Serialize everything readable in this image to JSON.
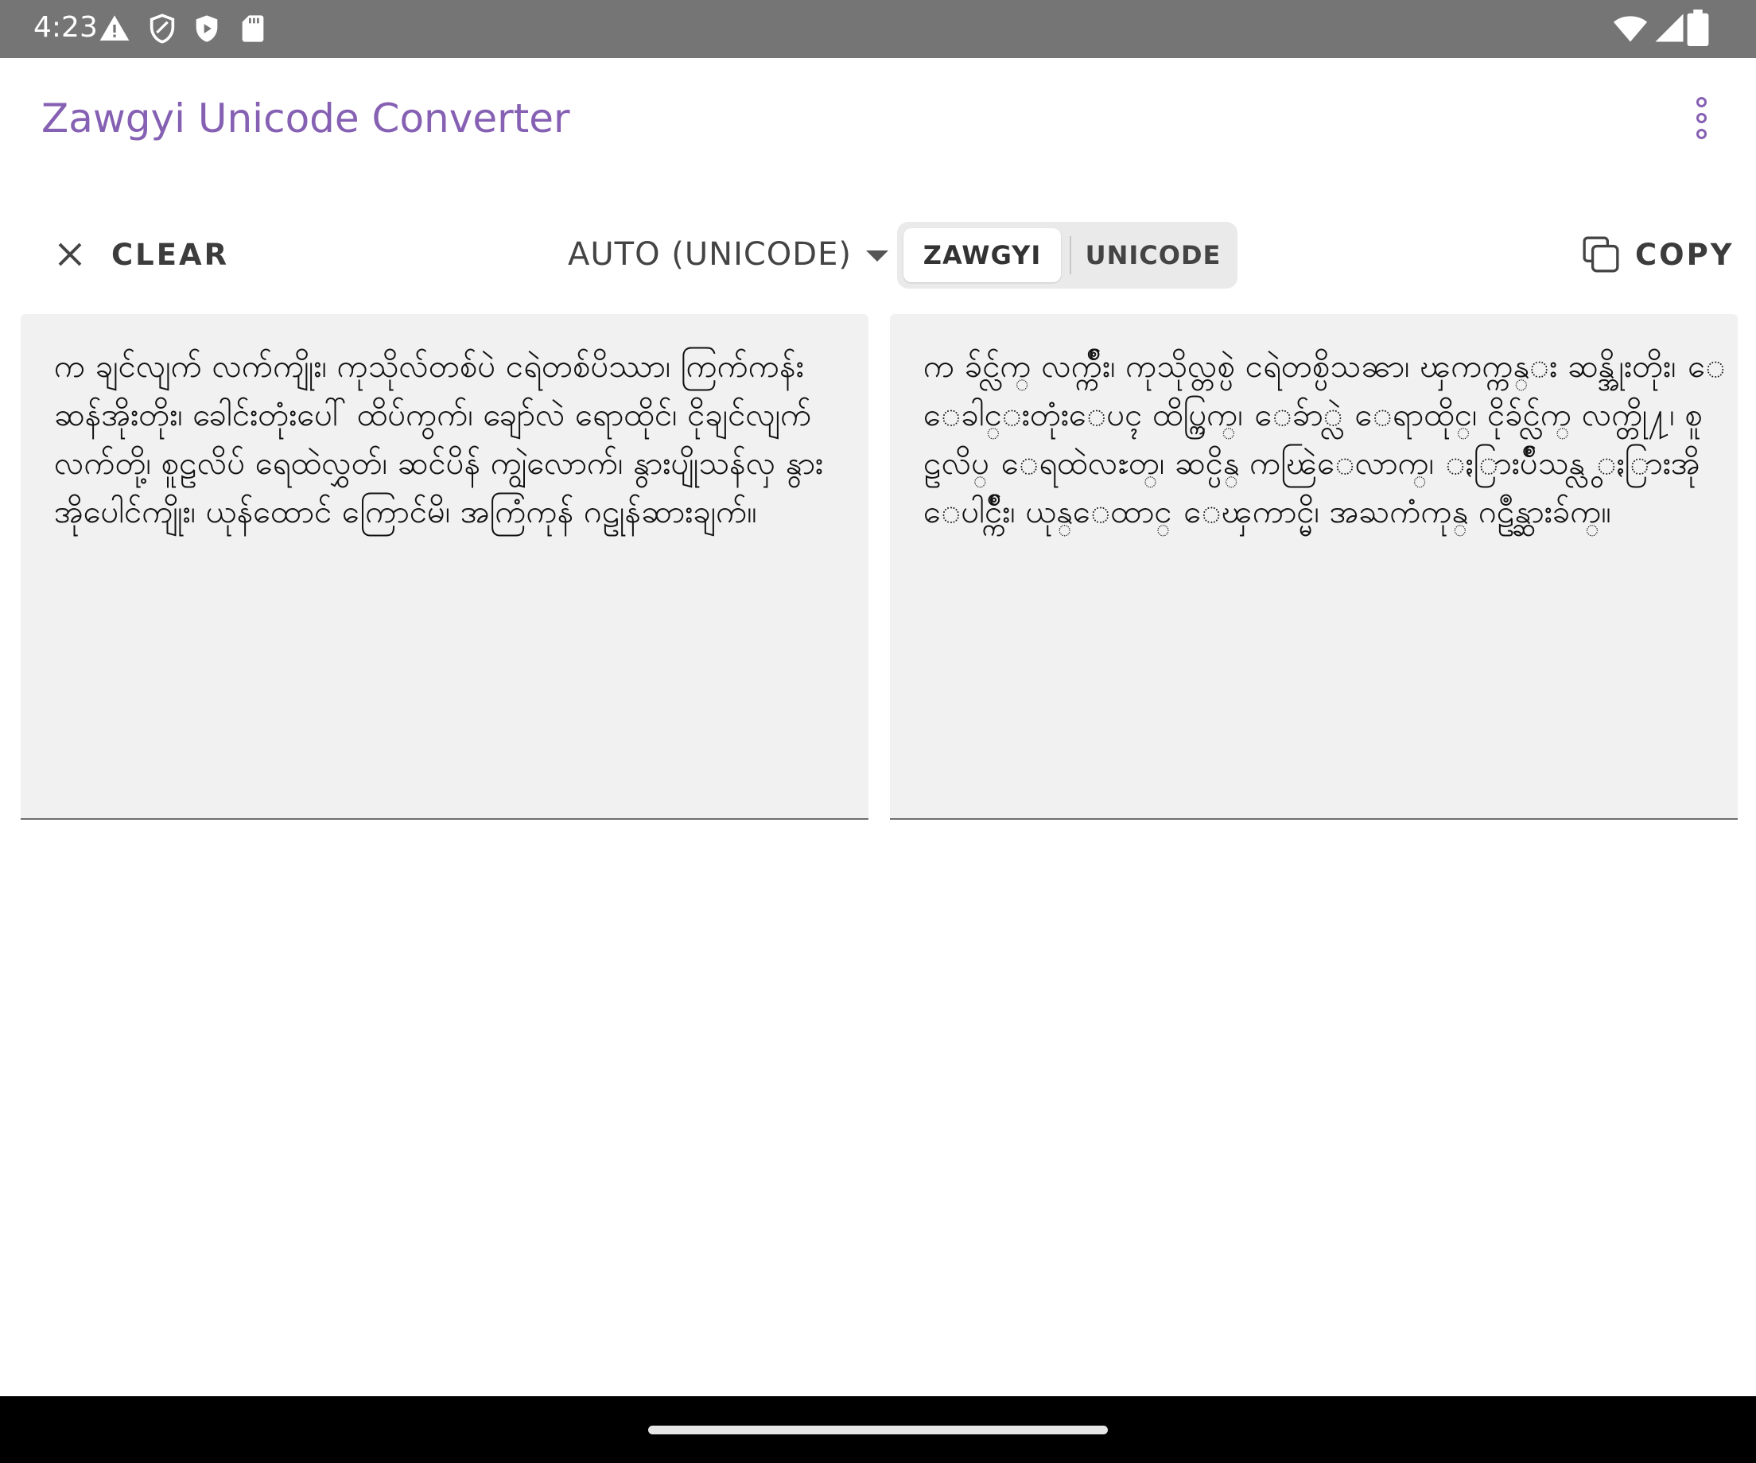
{
  "status_bar": {
    "time": "4:23",
    "left_icons": [
      "warning-icon",
      "shield-icon",
      "play-protect-icon",
      "sd-card-icon"
    ],
    "right_icons": [
      "wifi-icon",
      "signal-icon",
      "battery-icon"
    ]
  },
  "app_bar": {
    "title": "Zawgyi Unicode Converter",
    "overflow_icon": "more-vert-icon",
    "accent_color": "#8560b3"
  },
  "toolbar": {
    "clear_label": "CLEAR",
    "clear_icon": "close-icon",
    "mode_selected": "AUTO (UNICODE)",
    "target_options": [
      "ZAWGYI",
      "UNICODE"
    ],
    "target_selected": "ZAWGYI",
    "copy_label": "COPY",
    "copy_icon": "copy-icon"
  },
  "input": {
    "text": "က ချင်လျက် လက်ကျိုး၊ ကုသိုလ်တစ်ပဲ ငရဲတစ်ပိဿာ၊ ကြက်ကန်း ဆန်အိုးတိုး၊ ခေါင်းတုံးပေါ် ထိပ်ကွက်၊ ချော်လဲ ရောထိုင်၊ ငိုချင်လျက် လက်တို့၊ စူဠလိပ် ရေထဲလွှတ်၊ ဆင်ပိန် ကျွဲလောက်၊ နွားပျိုသန်လှ နွားအိုပေါင်ကျိုး၊ ယုန်ထောင် ကြောင်မိ၊ အကြံကုန် ဂဠုန်ဆားချက်။"
  },
  "output": {
    "text": "က ခ်င္လ်က္ လက္က်ိဳး၊ ကုသိုလ္တစ္ပဲ ငရဲတစ္ပိသၼာ၊ ၾကက္ကန္း ဆန္အိုးတိုး၊ ေခါင္းတုံးေပၚ ထိပ္ကြက္၊ ေခ်ာ္လဲ ေရာထိုင္၊ ငိုခ်င္လ်က္ လက္တို႔၊ စူဠလိပ္ ေရထဲလႊတ္၊ ဆင္ပိန္ ကၽြဲေလာက္၊ ႏြားပ်ိဳသန္လွ ႏြားအိုေပါင္က်ိဳး၊ ယုန္ေထာင္ ေၾကာင္မိ၊ အႀကံကုန္ ဂဠဳန္ဆားခ်က္။"
  },
  "nav_bar": {
    "home_icon": "home-pill-icon"
  }
}
